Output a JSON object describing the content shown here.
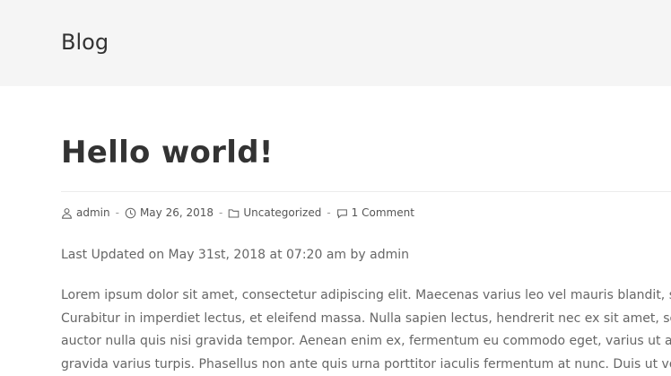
{
  "header": {
    "title": "Blog"
  },
  "post": {
    "title": "Hello world!",
    "meta": {
      "author": "admin",
      "date": "May 26, 2018",
      "category": "Uncategorized",
      "comments": "1 Comment",
      "separator": "-"
    },
    "updated": "Last Updated on May 31st, 2018 at 07:20 am by admin",
    "body_lines": [
      "Lorem ipsum dolor sit amet, consectetur adipiscing elit. Maecenas varius leo vel mauris blandit, sit amet",
      "Curabitur in imperdiet lectus, et eleifend massa. Nulla sapien lectus, hendrerit nec ex sit amet, sodales ve",
      "auctor nulla quis nisi gravida tempor. Aenean enim ex, fermentum eu commodo eget, varius ut arcu. Inte",
      "gravida varius turpis. Phasellus non ante quis urna porttitor iaculis fermentum at nunc. Duis ut volutpat p"
    ]
  },
  "icons": {
    "author": "user-icon",
    "date": "clock-icon",
    "category": "folder-icon",
    "comments": "comment-icon"
  },
  "colors": {
    "header_bg": "#f5f5f5",
    "text": "#333333",
    "muted": "#666666"
  }
}
